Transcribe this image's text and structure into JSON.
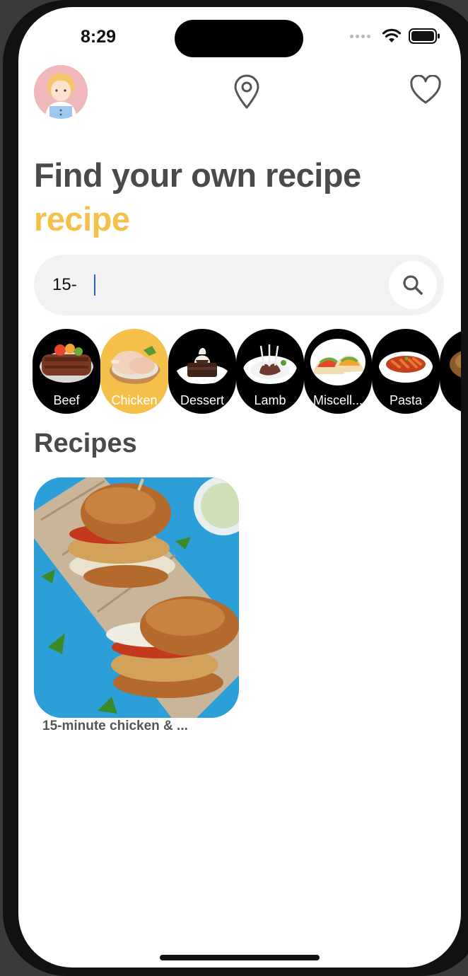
{
  "status_bar": {
    "time": "8:29"
  },
  "header": {
    "avatar_icon": "user-avatar",
    "location_icon": "map-pin-icon",
    "favorite_icon": "heart-icon"
  },
  "hero": {
    "title": "Find your own recipe",
    "title_accent": "recipe",
    "accent_color": "#f5c04a",
    "text_color": "#4a4a4a"
  },
  "search": {
    "value": "15-",
    "button_icon": "search-icon"
  },
  "categories": [
    {
      "label": "Beef",
      "active": false
    },
    {
      "label": "Chicken",
      "active": true
    },
    {
      "label": "Dessert",
      "active": false
    },
    {
      "label": "Lamb",
      "active": false
    },
    {
      "label": "Miscell...",
      "active": false
    },
    {
      "label": "Pasta",
      "active": false
    },
    {
      "label": "",
      "active": false
    }
  ],
  "recipes_section": {
    "title": "Recipes",
    "items": [
      {
        "name": "15-minute chicken & ..."
      }
    ]
  }
}
